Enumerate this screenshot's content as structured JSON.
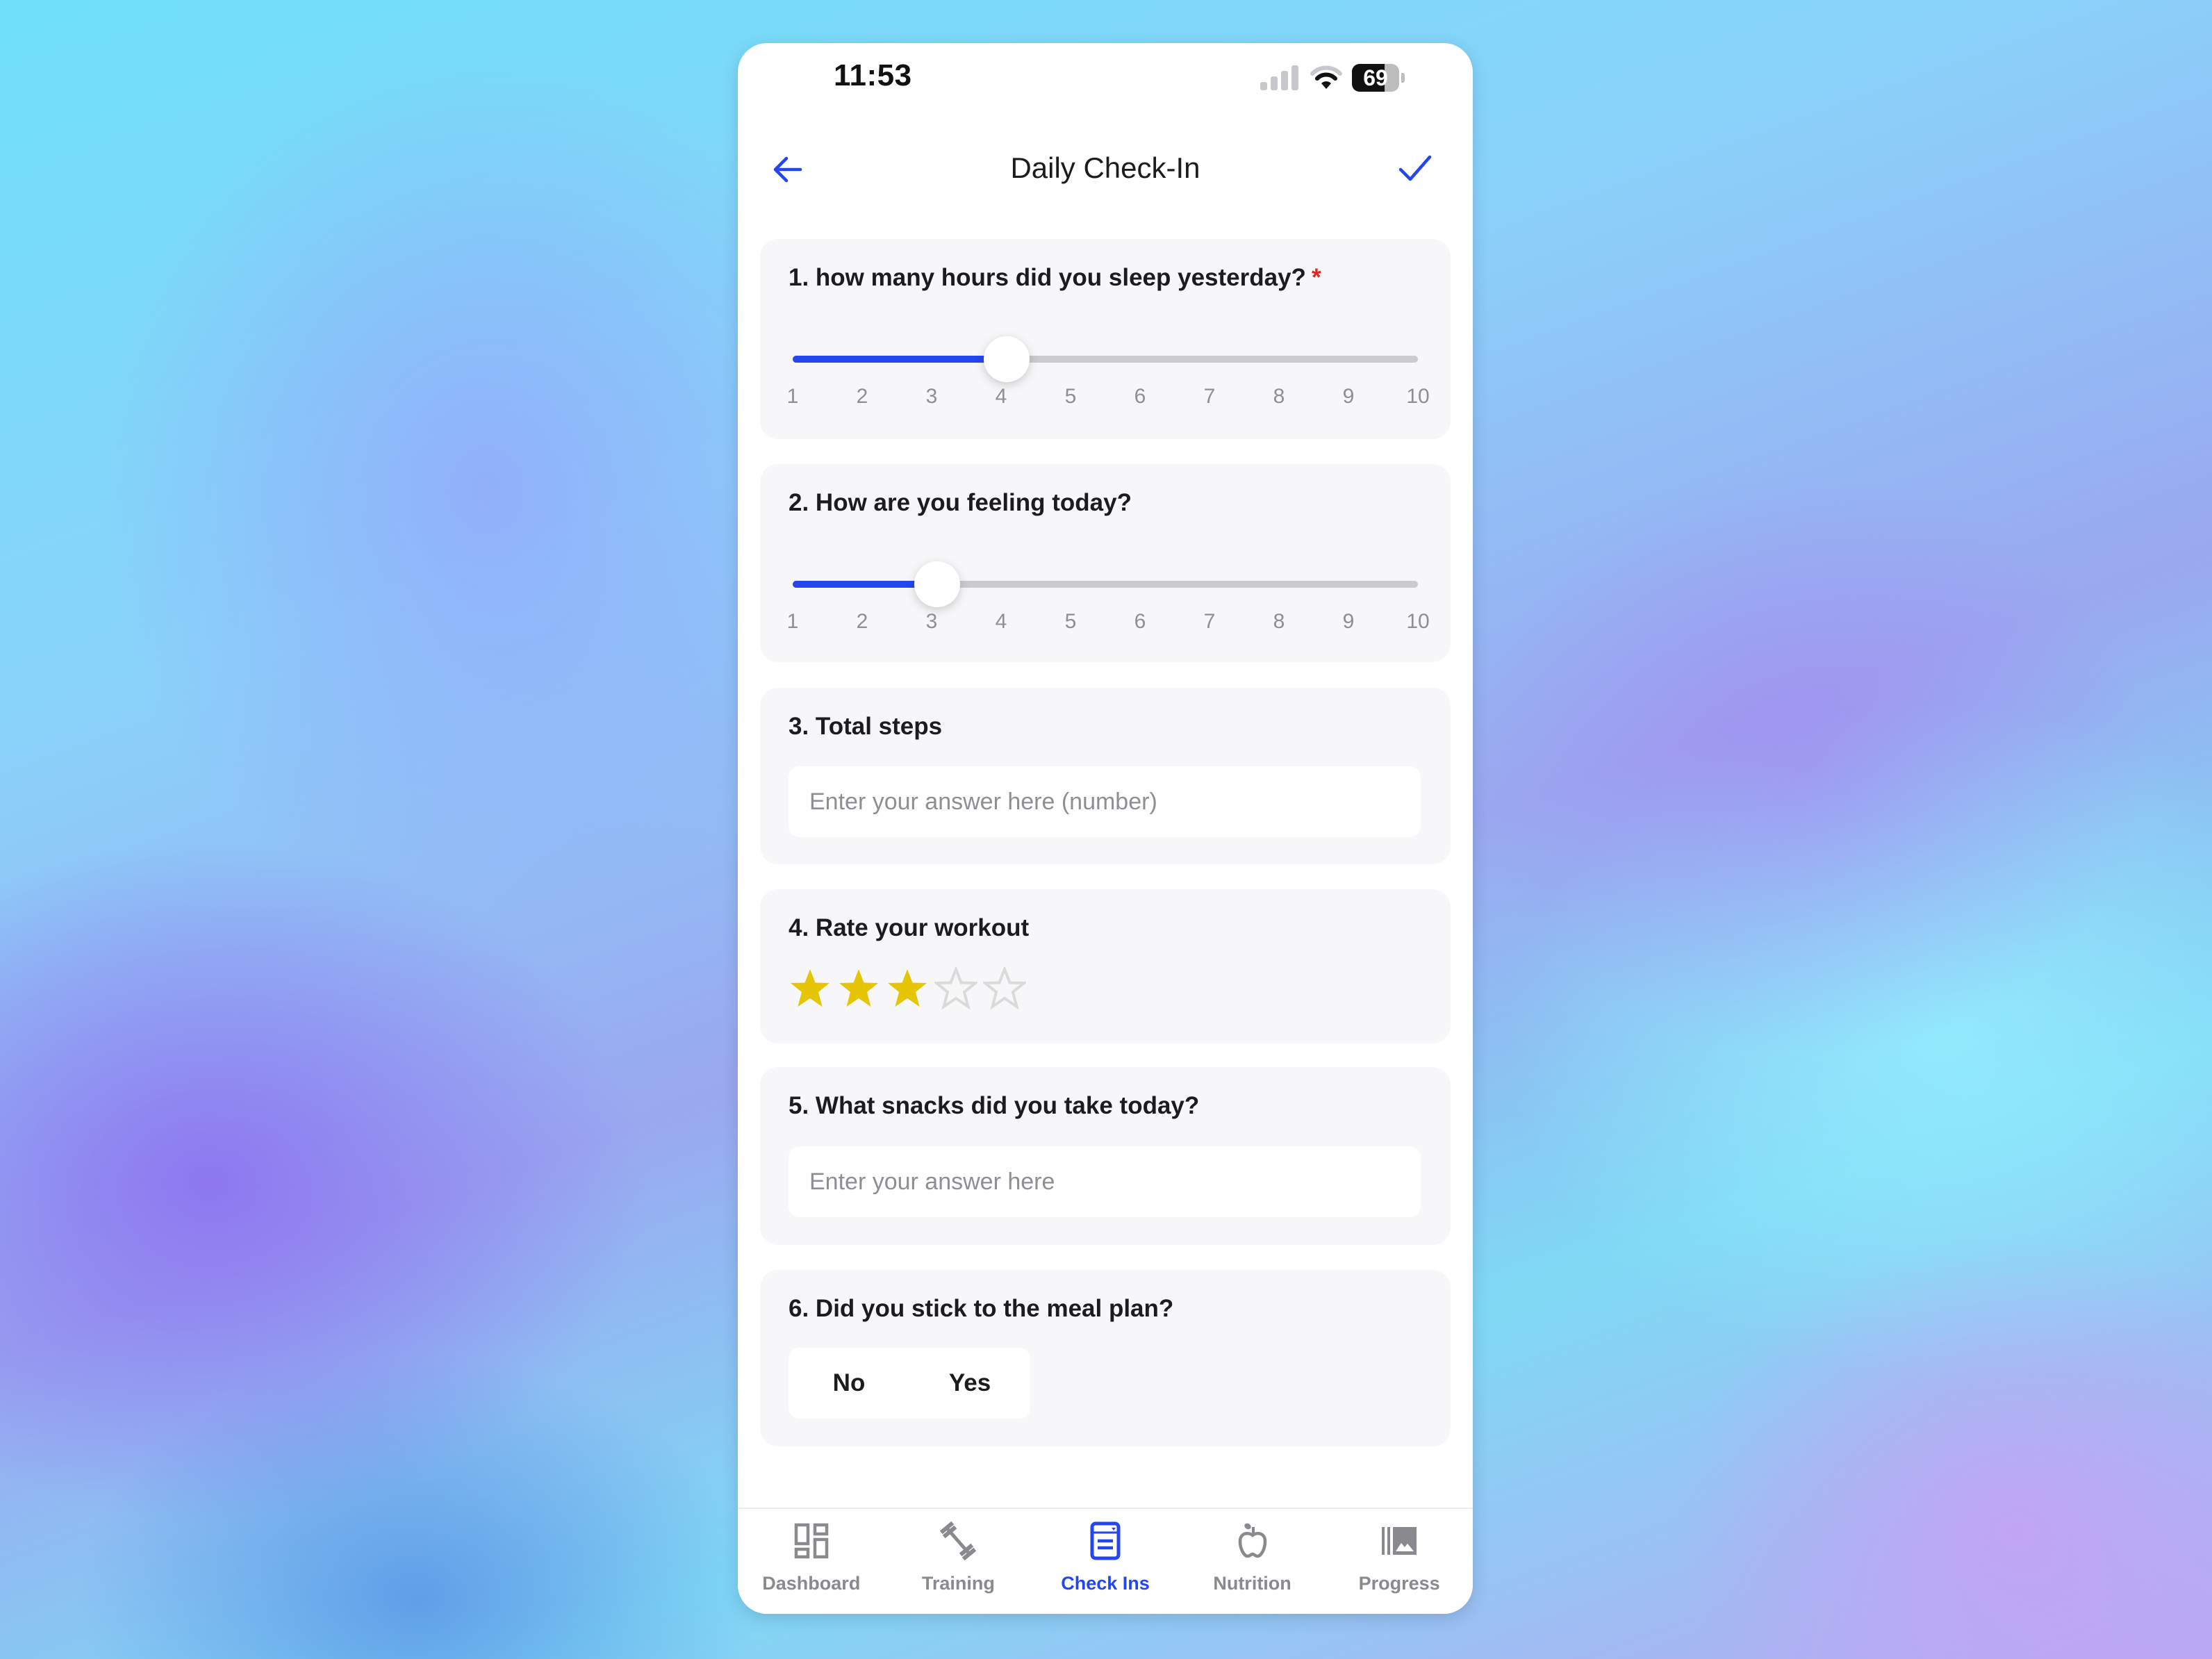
{
  "status_bar": {
    "time": "11:53",
    "signal_bars_active": 1,
    "signal_bars_total": 4,
    "wifi_icon": "wifi-icon",
    "battery_percent": "69"
  },
  "header": {
    "title": "Daily Check-In",
    "back_icon": "arrow-left-icon",
    "confirm_icon": "checkmark-icon"
  },
  "colors": {
    "accent": "#2446f0",
    "star_filled": "#e6c505",
    "star_empty": "#dadada",
    "required": "#e5241b",
    "card_bg": "#f7f7f9",
    "track": "#cbcbcf",
    "muted_text": "#8e8e93"
  },
  "questions": [
    {
      "title": "1. how many hours did you sleep yesterday?",
      "required_mark": "*",
      "type": "slider",
      "min": 1,
      "max": 10,
      "value": 4,
      "ticks": [
        "1",
        "2",
        "3",
        "4",
        "5",
        "6",
        "7",
        "8",
        "9",
        "10"
      ]
    },
    {
      "title": "2. How are you feeling today?",
      "type": "slider",
      "min": 1,
      "max": 10,
      "value": 3,
      "ticks": [
        "1",
        "2",
        "3",
        "4",
        "5",
        "6",
        "7",
        "8",
        "9",
        "10"
      ]
    },
    {
      "title": "3. Total steps",
      "type": "number_input",
      "value": "",
      "placeholder": "Enter your answer here (number)"
    },
    {
      "title": "4. Rate your workout",
      "type": "star_rating",
      "rating": 3,
      "max_rating": 5
    },
    {
      "title": "5. What snacks did you take today?",
      "type": "text_input",
      "value": "",
      "placeholder": "Enter your answer here"
    },
    {
      "title": "6. Did you stick to the meal plan?",
      "type": "yes_no",
      "options": [
        "No",
        "Yes"
      ],
      "selected": null
    }
  ],
  "tab_bar": {
    "active_index": 2,
    "items": [
      {
        "label": "Dashboard",
        "icon": "dashboard-icon"
      },
      {
        "label": "Training",
        "icon": "dumbbell-icon"
      },
      {
        "label": "Check Ins",
        "icon": "checkin-form-icon"
      },
      {
        "label": "Nutrition",
        "icon": "apple-icon"
      },
      {
        "label": "Progress",
        "icon": "gallery-icon"
      }
    ]
  }
}
